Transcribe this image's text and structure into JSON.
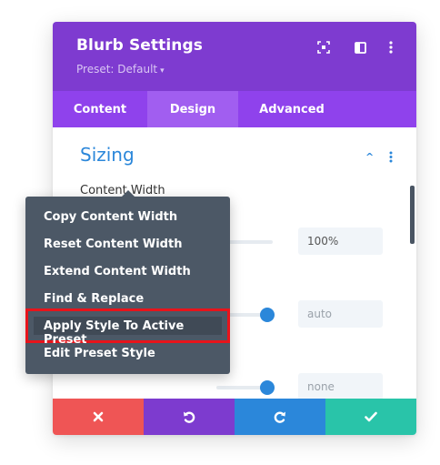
{
  "header": {
    "title": "Blurb Settings",
    "preset_label": "Preset: Default",
    "preset_caret": "▾"
  },
  "tabs": [
    {
      "label": "Content",
      "active": false
    },
    {
      "label": "Design",
      "active": true
    },
    {
      "label": "Advanced",
      "active": false
    }
  ],
  "section": {
    "title": "Sizing",
    "collapse_glyph": "^"
  },
  "fields": [
    {
      "label": "Content Width",
      "value": "100%",
      "muted": false
    },
    {
      "label": "",
      "value": "auto",
      "muted": true
    },
    {
      "label": "",
      "value": "none",
      "muted": true
    }
  ],
  "context_menu": {
    "items": [
      {
        "label": "Copy Content Width"
      },
      {
        "label": "Reset Content Width"
      },
      {
        "label": "Extend Content Width"
      },
      {
        "label": "Find & Replace"
      },
      {
        "label": "Apply Style To Active Preset",
        "highlighted": true
      },
      {
        "label": "Edit Preset Style"
      }
    ]
  },
  "footer": {
    "cancel_icon": "close-icon",
    "undo_icon": "undo-icon",
    "redo_icon": "redo-icon",
    "save_icon": "check-icon"
  },
  "colors": {
    "header_bg": "#7e3bd0",
    "tab_bg": "#8f42ec",
    "tab_active_bg": "#a15ef0",
    "accent_blue": "#2b87da",
    "menu_bg": "#4c5866",
    "highlight_border": "#e8141b",
    "cancel": "#ef5555",
    "undo": "#7d3bcf",
    "redo": "#2b87da",
    "save": "#29c4a9"
  }
}
